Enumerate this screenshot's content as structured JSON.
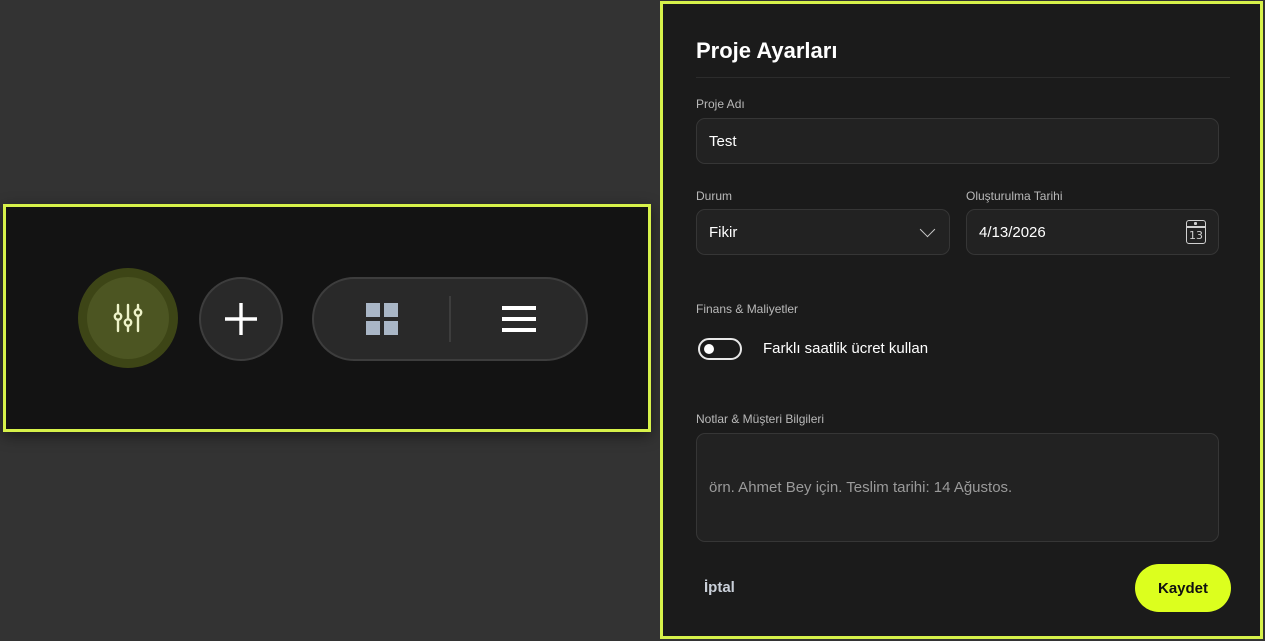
{
  "colors": {
    "accent": "#d7f24a",
    "save_button": "#dcff1e",
    "panel": "#1b1b1b",
    "toolbar": "#131313"
  },
  "toolbar": {
    "filter_icon": "sliders-icon",
    "add_icon": "plus-icon",
    "grid_view_icon": "grid-icon",
    "list_view_icon": "menu-lines-icon"
  },
  "settings": {
    "title": "Proje Ayarları",
    "project_name": {
      "label": "Proje Adı",
      "value": "Test"
    },
    "status": {
      "label": "Durum",
      "value": "Fikir"
    },
    "created_date": {
      "label": "Oluşturulma Tarihi",
      "value": "4/13/2026",
      "calendar_day": "13"
    },
    "finance": {
      "label": "Finans & Maliyetler",
      "toggle_label": "Farklı saatlik ücret kullan",
      "toggle_on": false
    },
    "notes": {
      "label": "Notlar & Müşteri Bilgileri",
      "placeholder": "örn. Ahmet Bey için. Teslim tarihi: 14 Ağustos."
    },
    "cancel_label": "İptal",
    "save_label": "Kaydet"
  }
}
